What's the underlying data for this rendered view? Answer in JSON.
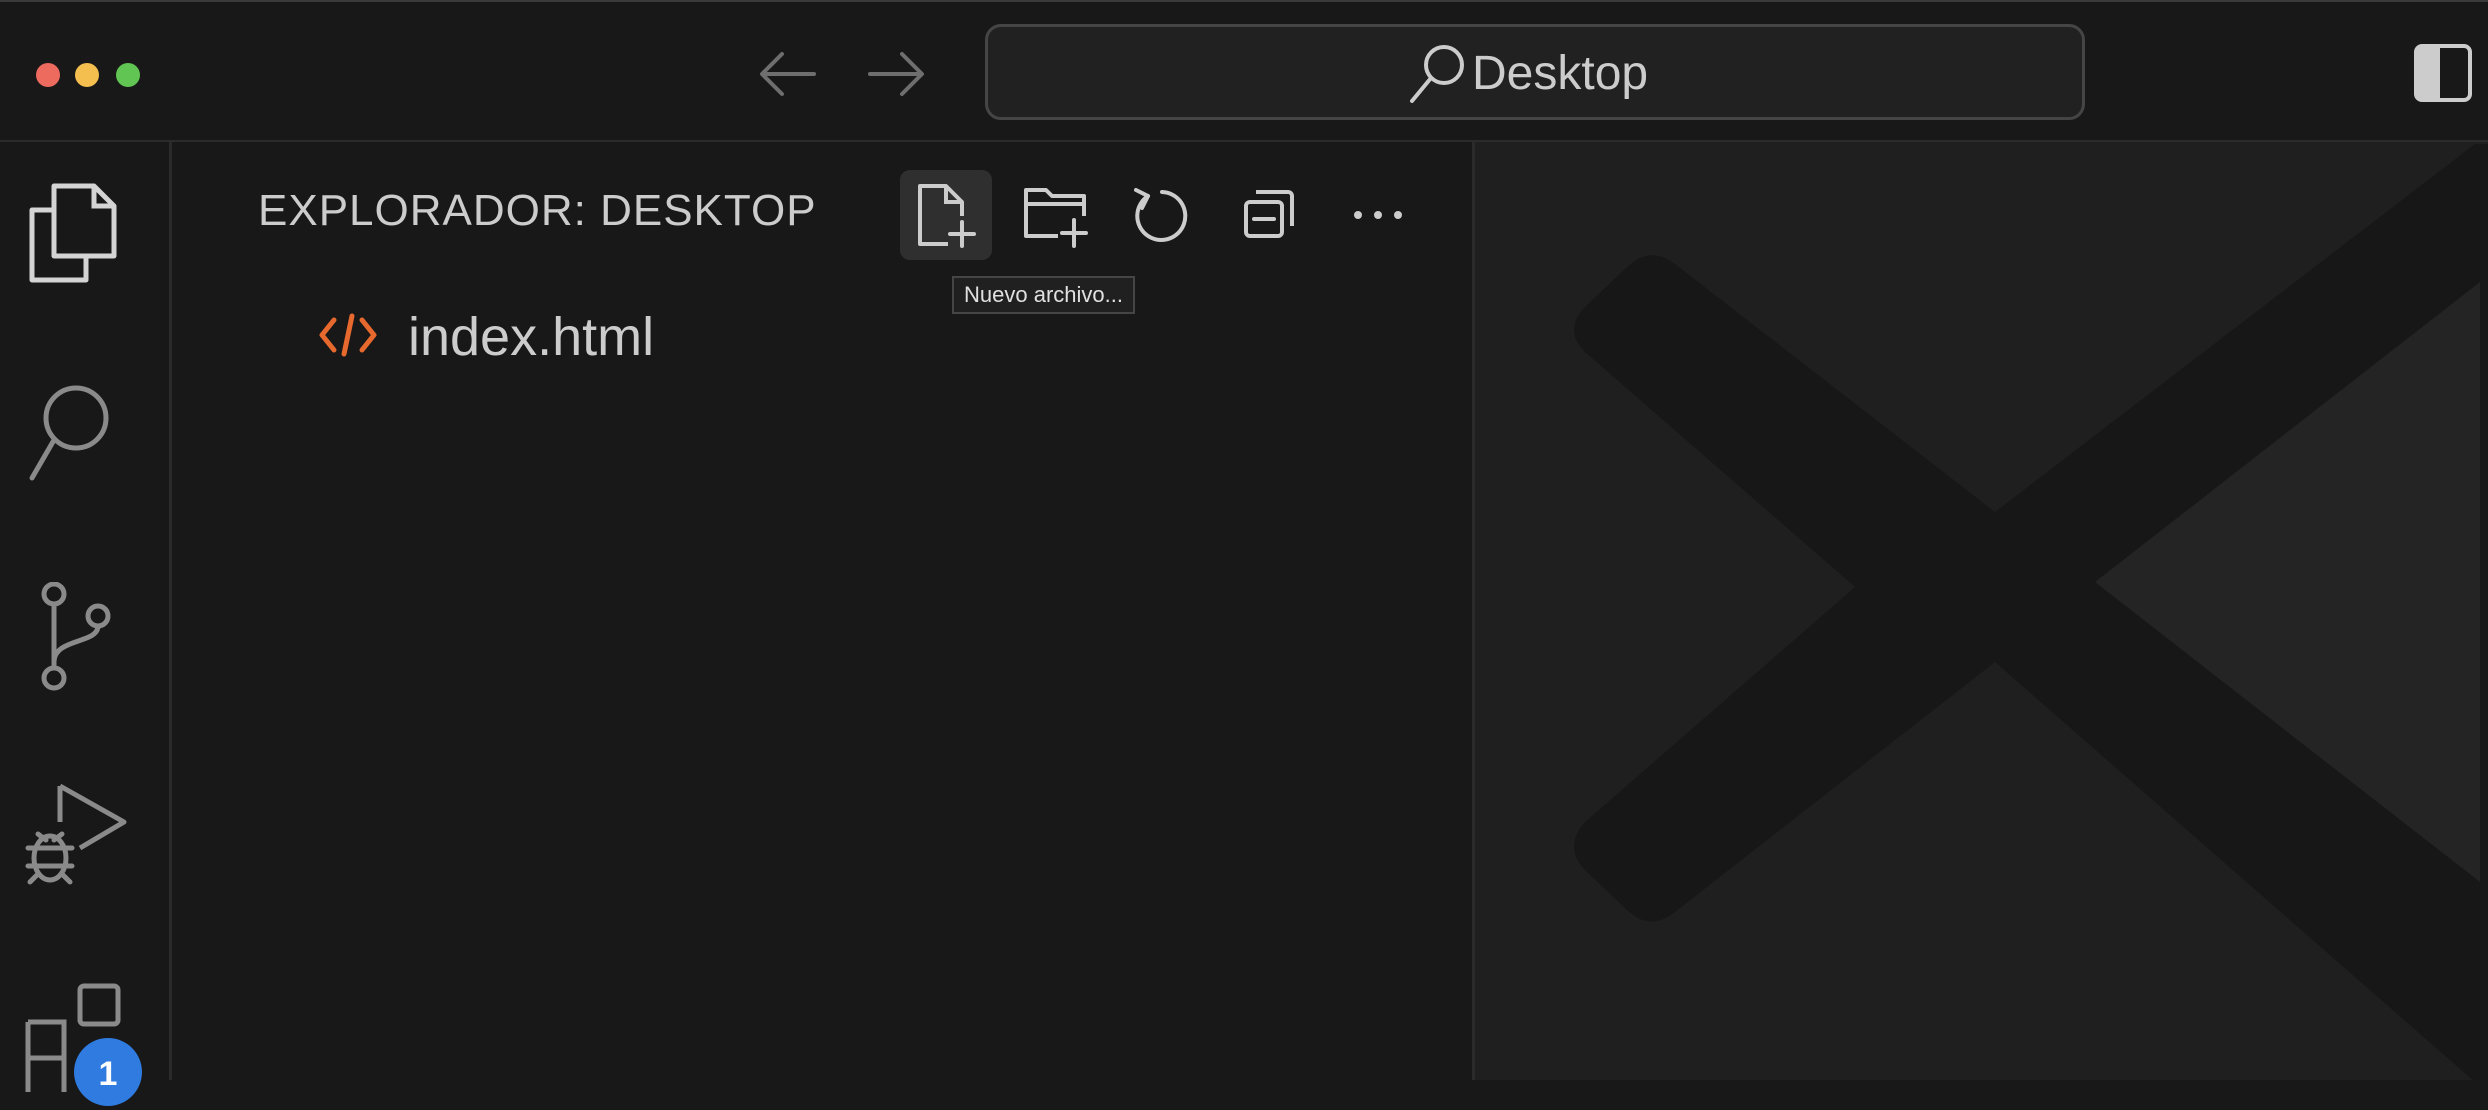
{
  "window": {
    "traffic_lights": [
      "close",
      "minimize",
      "zoom"
    ],
    "colors": {
      "close": "#ed6a5e",
      "minimize": "#f4bf4f",
      "zoom": "#61c554"
    }
  },
  "titlebar": {
    "back_icon": "arrow-left-icon",
    "forward_icon": "arrow-right-icon",
    "command_center": {
      "icon": "search-icon",
      "text": "Desktop"
    },
    "layout_icon": "toggle-sidebar-icon"
  },
  "activity_bar": {
    "items": [
      {
        "name": "explorer",
        "icon": "files-icon",
        "active": true
      },
      {
        "name": "search",
        "icon": "search-icon"
      },
      {
        "name": "source-control",
        "icon": "source-control-icon"
      },
      {
        "name": "run-and-debug",
        "icon": "run-debug-icon"
      },
      {
        "name": "extensions",
        "icon": "extensions-icon",
        "badge": "1"
      }
    ],
    "badge_color": "#2f7be0"
  },
  "sidebar": {
    "title": "EXPLORADOR: DESKTOP",
    "toolbar": [
      {
        "icon": "new-file-icon",
        "hovered": true
      },
      {
        "icon": "new-folder-icon"
      },
      {
        "icon": "refresh-icon"
      },
      {
        "icon": "collapse-all-icon"
      },
      {
        "icon": "more-icon"
      }
    ],
    "tooltip": "Nuevo archivo...",
    "files": [
      {
        "name": "index.html",
        "icon": "html-file-icon",
        "icon_color": "#e8692e"
      }
    ]
  },
  "editor": {
    "watermark": "vscode-logo-icon"
  }
}
